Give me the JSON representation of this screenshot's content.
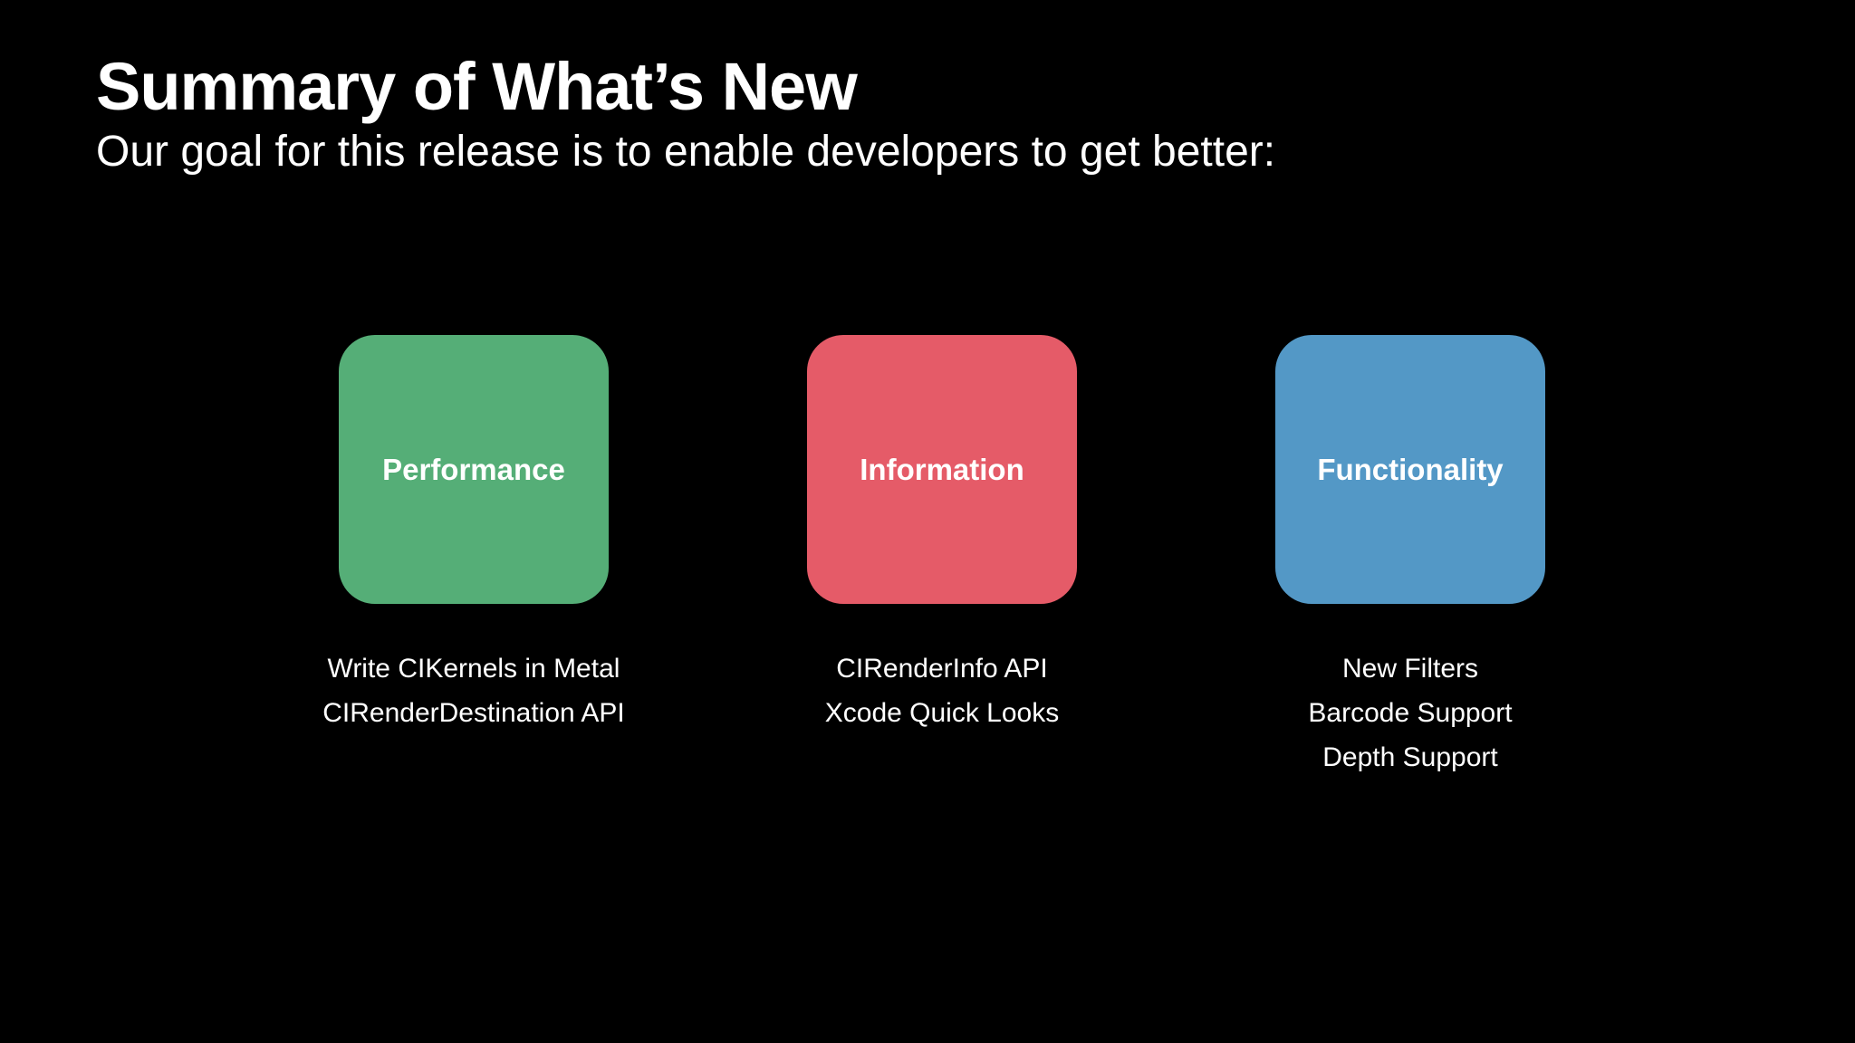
{
  "slide": {
    "title": "Summary of What’s New",
    "subtitle": "Our goal for this release is to enable developers to get better:"
  },
  "categories": [
    {
      "label": "Performance",
      "color": "#55AE77",
      "items": [
        "Write CIKernels in Metal",
        "CIRenderDestination API"
      ]
    },
    {
      "label": "Information",
      "color": "#E55B68",
      "items": [
        "CIRenderInfo API",
        "Xcode Quick Looks"
      ]
    },
    {
      "label": "Functionality",
      "color": "#5398C6",
      "items": [
        "New Filters",
        "Barcode Support",
        "Depth Support"
      ]
    }
  ]
}
